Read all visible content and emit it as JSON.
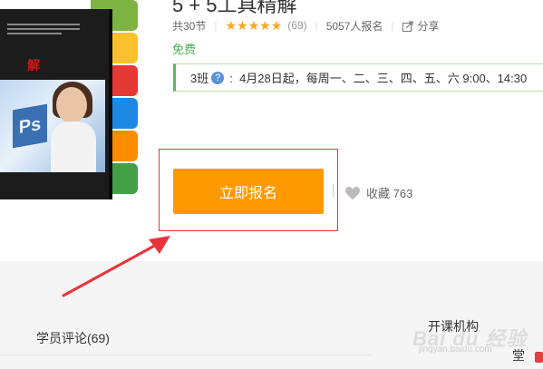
{
  "course": {
    "title": "5 + 5工具精解",
    "lessons": "共30节",
    "rating_stars": "★★★★★",
    "rating_count": "(69)",
    "enrolled": "5057人报名",
    "share_label": "分享",
    "price": "免费"
  },
  "class_info": {
    "class_name": "3班",
    "schedule": "4月28日起，每周一、二、三、四、五、六 9:00、14:30"
  },
  "cover": {
    "red_title": "解"
  },
  "actions": {
    "signup_label": "立即报名",
    "favorite_label": "收藏 763"
  },
  "tabs": {
    "reviews_label": "学员评论(69)",
    "org_label": "开课机构",
    "cut_text": "堂"
  },
  "watermark": {
    "main": "Bai du 经验",
    "sub": "jingyan.baidu.com"
  },
  "colors": {
    "accent_orange": "#ff9900",
    "star_color": "#f5a623",
    "free_green": "#4caf50",
    "annotation_red": "#e8343a"
  },
  "icons": [
    "star-icon",
    "share-icon",
    "help-icon",
    "heart-icon"
  ]
}
